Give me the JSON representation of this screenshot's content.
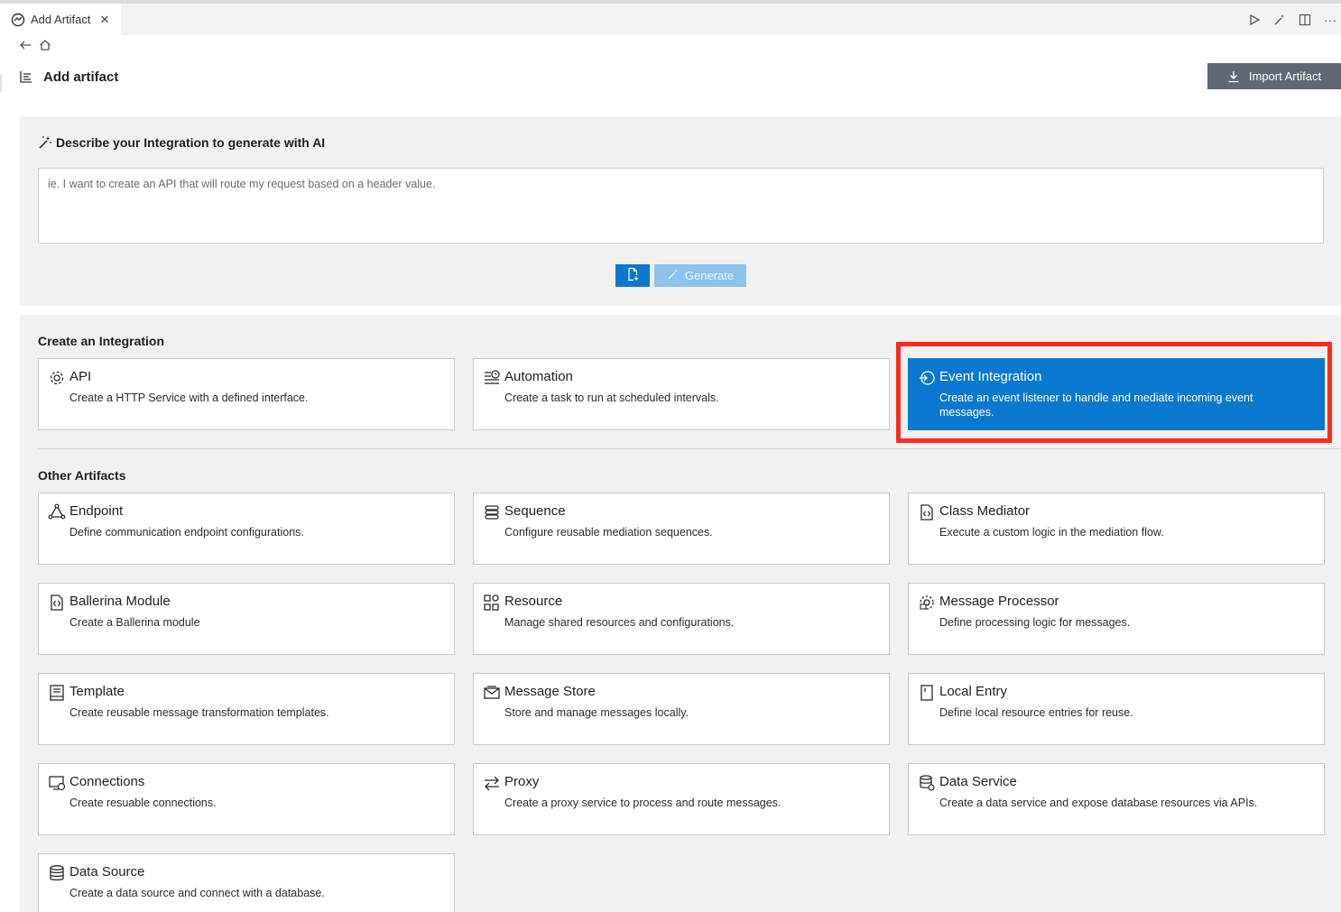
{
  "tab": {
    "title": "Add Artifact",
    "close": "✕"
  },
  "tab_actions": {
    "more": "···"
  },
  "header": {
    "title": "Add artifact",
    "import_label": "Import Artifact"
  },
  "ai": {
    "title": "Describe your Integration to generate with AI",
    "placeholder": "ie. I want to create an API that will route my request based on a header value.",
    "generate_label": "Generate"
  },
  "integration_section": {
    "title": "Create an Integration",
    "cards": [
      {
        "title": "API",
        "desc": "Create a HTTP Service with a defined interface.",
        "icon": "gear-icon"
      },
      {
        "title": "Automation",
        "desc": "Create a task to run at scheduled intervals.",
        "icon": "schedule-icon"
      },
      {
        "title": "Event Integration",
        "desc": "Create an event listener to handle and mediate incoming event messages.",
        "icon": "event-icon",
        "selected": true
      }
    ]
  },
  "other_section": {
    "title": "Other Artifacts",
    "cards": [
      {
        "title": "Endpoint",
        "desc": "Define communication endpoint configurations.",
        "icon": "endpoint-icon"
      },
      {
        "title": "Sequence",
        "desc": "Configure reusable mediation sequences.",
        "icon": "sequence-icon"
      },
      {
        "title": "Class Mediator",
        "desc": "Execute a custom logic in the mediation flow.",
        "icon": "code-file-icon"
      },
      {
        "title": "Ballerina Module",
        "desc": "Create a Ballerina module",
        "icon": "module-icon"
      },
      {
        "title": "Resource",
        "desc": "Manage shared resources and configurations.",
        "icon": "resource-icon"
      },
      {
        "title": "Message Processor",
        "desc": "Define processing logic for messages.",
        "icon": "processor-icon"
      },
      {
        "title": "Template",
        "desc": "Create reusable message transformation templates.",
        "icon": "template-icon"
      },
      {
        "title": "Message Store",
        "desc": "Store and manage messages locally.",
        "icon": "message-store-icon"
      },
      {
        "title": "Local Entry",
        "desc": "Define local resource entries for reuse.",
        "icon": "local-entry-icon"
      },
      {
        "title": "Connections",
        "desc": "Create resuable connections.",
        "icon": "connections-icon"
      },
      {
        "title": "Proxy",
        "desc": "Create a proxy service to process and route messages.",
        "icon": "proxy-icon"
      },
      {
        "title": "Data Service",
        "desc": "Create a data service and expose database resources via APIs.",
        "icon": "data-service-icon"
      },
      {
        "title": "Data Source",
        "desc": "Create a data source and connect with a database.",
        "icon": "database-icon"
      }
    ]
  },
  "colors": {
    "accent": "#0b78d0",
    "highlight": "#ff2a1a",
    "button_gray": "#5f6873",
    "panel_bg": "#f1f1f1"
  }
}
